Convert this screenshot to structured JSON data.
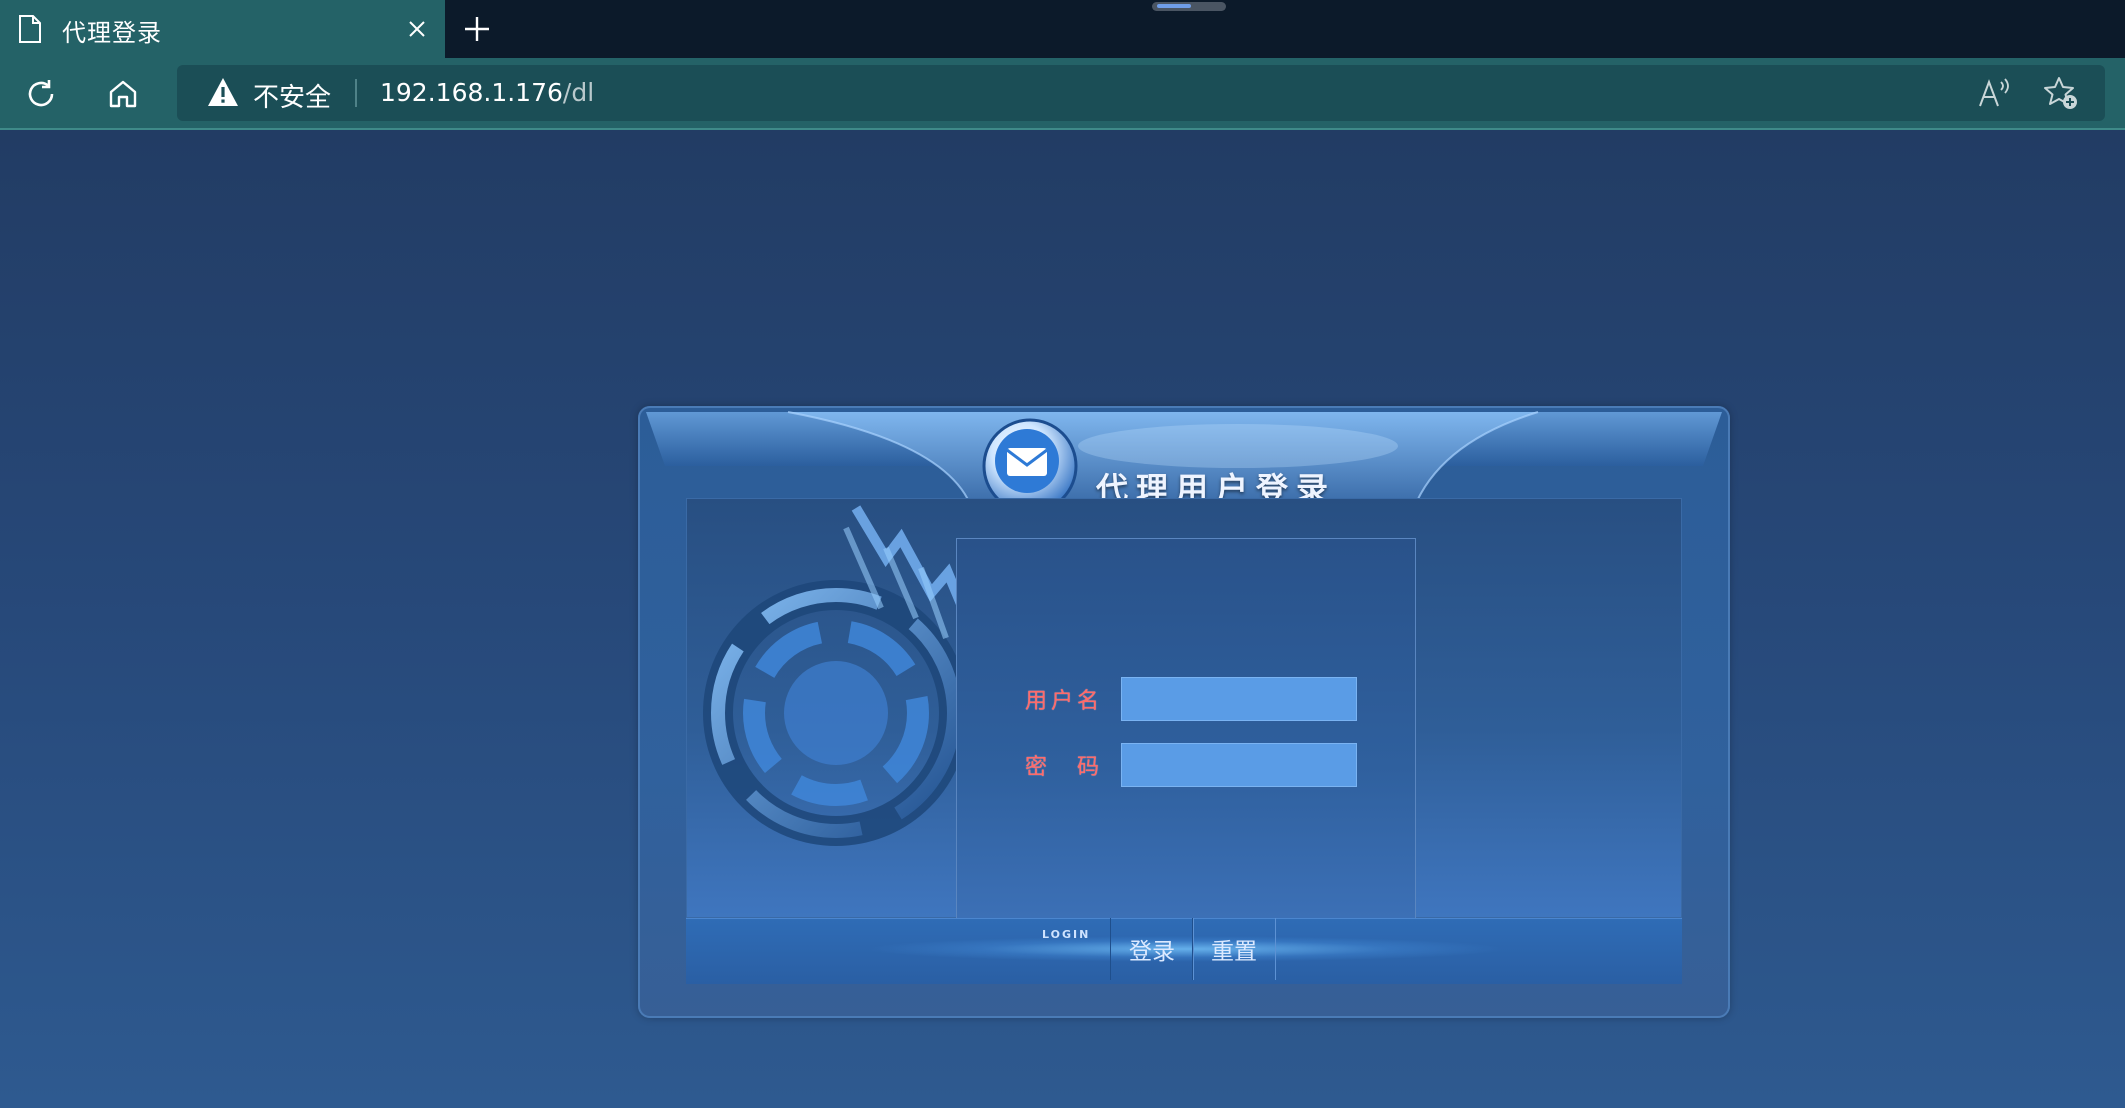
{
  "browser": {
    "tab": {
      "title": "代理登录"
    },
    "address_bar": {
      "security_label": "不安全",
      "url_host": "192.168.1.176",
      "url_path": "/dl"
    },
    "icons": [
      "page-icon",
      "close-icon",
      "plus-icon",
      "refresh-icon",
      "home-icon",
      "warning-icon",
      "read-aloud-icon",
      "add-favorite-icon"
    ]
  },
  "login": {
    "title": "代理用户登录",
    "username_label": "用户名",
    "password_label": "密　码",
    "username_value": "",
    "password_value": "",
    "footer_tag": "LOGIN",
    "login_button": "登录",
    "reset_button": "重置",
    "icon": "envelope-icon"
  },
  "colors": {
    "browser_accent": "#246267",
    "page_background": "#27497a",
    "label_red": "#ff6a6a",
    "input_fill": "#5a9ce6"
  }
}
